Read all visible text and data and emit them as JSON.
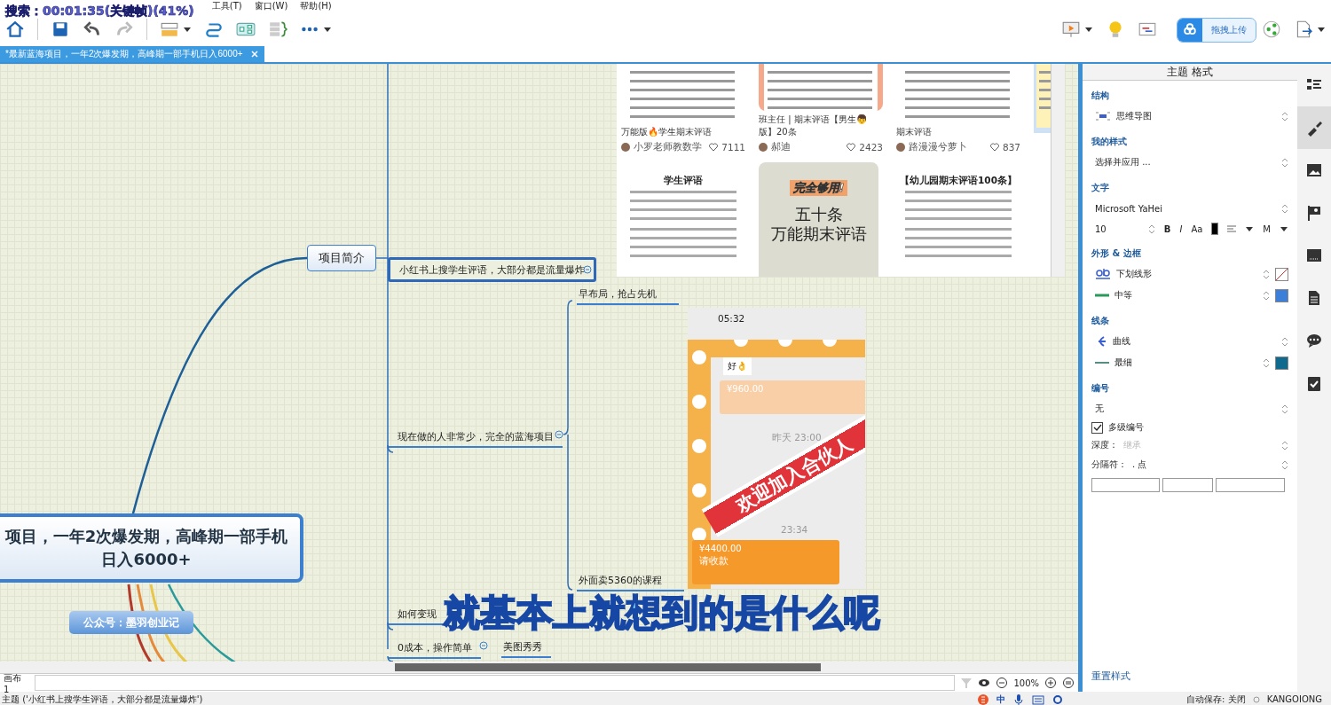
{
  "menu": [
    "工具(T)",
    "窗口(W)",
    "帮助(H)"
  ],
  "player_overlay": "搜索：00:01:35(关键帧)(41%)",
  "upload_overlay": {
    "label": "拖拽上传"
  },
  "tabs": [
    {
      "label": "*最新蓝海项目，一年2次爆发期，高峰期一部手机日入6000+",
      "selected": true
    }
  ],
  "mindmap": {
    "central": "项目，一年2次爆发期，高峰期一部手机日入6000+",
    "label_pill": "公众号：墨羽创业记",
    "main_topic": "项目简介",
    "subtopics": [
      {
        "text": "小红书上搜学生评语，大部分都是流量爆炸",
        "selected": true,
        "collapsible": true
      },
      {
        "text": "现在做的人非常少，完全的蓝海项目",
        "selected": false,
        "collapsible": true
      },
      {
        "text": "如何变现",
        "selected": false,
        "collapsible": false
      },
      {
        "text": "0成本，操作简单",
        "selected": false,
        "collapsible": true
      }
    ],
    "details": [
      "早布局，抢占先机",
      "外面卖5360的课程",
      "美图秀秀"
    ],
    "subtitle": "就基本上就想到的是什么呢"
  },
  "notes_screenshot": {
    "cards": [
      {
        "title": "万能版🔥学生期末评语",
        "author": "小罗老师教数学",
        "likes": "7111"
      },
      {
        "title": "班主任 | 期末评语【男生👦版】20条",
        "author": "郝迪",
        "likes": "2423"
      },
      {
        "title": "期末评语",
        "author": "路漫漫兮萝卜",
        "likes": "837"
      }
    ],
    "thumbnails": [
      {
        "kind": "doc",
        "title": "学生评语"
      },
      {
        "kind": "poster",
        "title": "完全够用!",
        "line1": "五十条",
        "line2": "万能期末评语"
      },
      {
        "kind": "doc",
        "title": "【幼儿园期末评语100条】"
      }
    ]
  },
  "chat_screenshot": {
    "time": "05:32",
    "message": "好👌",
    "transfer_1": "¥960.00",
    "timestamp_1": "昨天 23:00",
    "banner": "欢迎加入合伙人",
    "timestamp_2": "23:34",
    "transfer_2": "¥4400.00",
    "transfer_2_note": "请收款"
  },
  "format_panel": {
    "title": "主题 格式",
    "sections": [
      {
        "title": "结构",
        "rows": [
          {
            "kind": "select",
            "value": "思维导图"
          }
        ]
      },
      {
        "title": "我的样式",
        "rows": [
          {
            "kind": "select",
            "value": "选择并应用 ..."
          }
        ]
      },
      {
        "title": "文字",
        "rows": [
          {
            "kind": "select",
            "value": "Microsoft YaHei"
          },
          {
            "kind": "font",
            "size": "10",
            "bold": "B",
            "italic": "I",
            "case": "Aa",
            "color": "#000000",
            "weight": "M"
          }
        ]
      },
      {
        "title": "外形 & 边框",
        "rows": [
          {
            "kind": "select",
            "value": "下划线形",
            "no_fill": true
          },
          {
            "kind": "select",
            "value": "中等",
            "color": "#3c7fd9"
          }
        ]
      },
      {
        "title": "线条",
        "rows": [
          {
            "kind": "select",
            "value": "曲线"
          },
          {
            "kind": "select",
            "value": "最细",
            "color": "#0f6a8e"
          }
        ]
      },
      {
        "title": "编号",
        "rows": [
          {
            "kind": "select",
            "value": "无"
          },
          {
            "kind": "check",
            "label": "多级编号",
            "checked": true
          },
          {
            "kind": "labeled",
            "label": "深度：",
            "value": "继承",
            "disabled": true
          },
          {
            "kind": "labeled",
            "label": "分隔符：",
            "value": ". 点",
            "disabled": false
          },
          {
            "kind": "fields"
          }
        ]
      }
    ],
    "reset": "重置样式"
  },
  "canvas_bar": {
    "sheet": "画布 1",
    "zoom": "100%"
  },
  "status_bar": {
    "topic": "主题 ('小红书上搜学生评语，大部分都是流量爆炸')",
    "ime": "中",
    "autosave": "自动保存: 关闭",
    "user": "KANGOIONG"
  }
}
